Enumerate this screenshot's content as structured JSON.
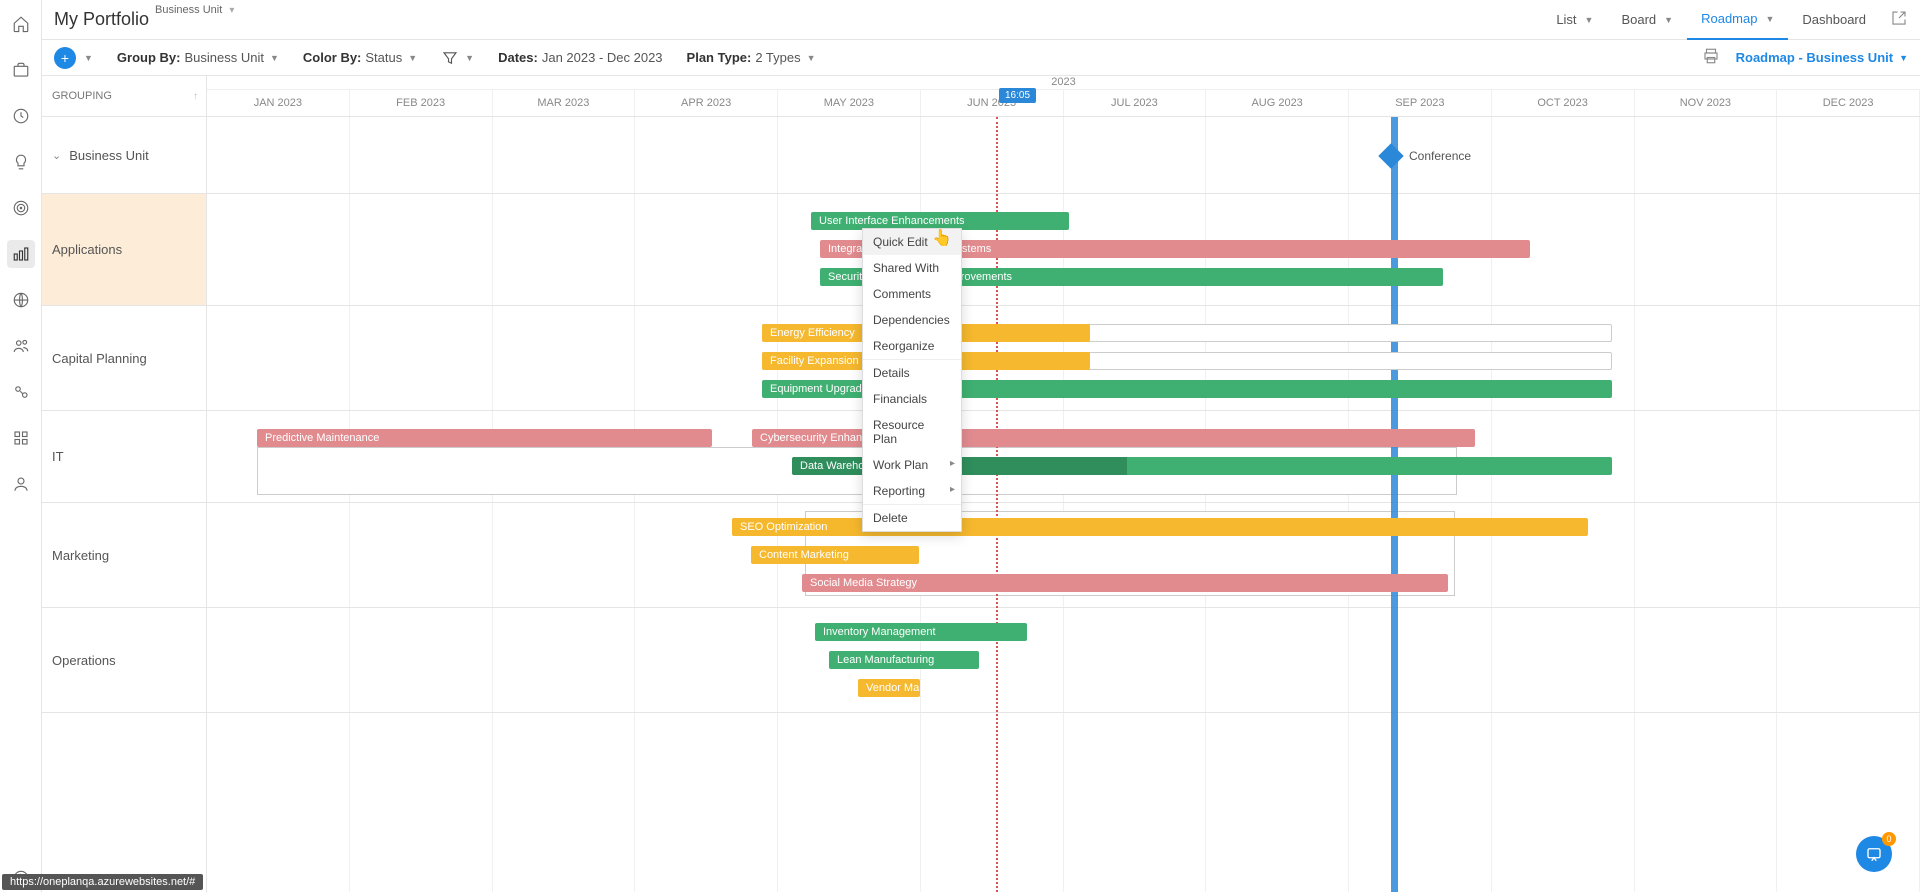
{
  "header": {
    "title": "My Portfolio",
    "subtitle": "Business Unit",
    "views": {
      "list": "List",
      "board": "Board",
      "roadmap": "Roadmap",
      "dashboard": "Dashboard"
    }
  },
  "toolbar": {
    "group_by_label": "Group By:",
    "group_by_value": "Business Unit",
    "color_by_label": "Color By:",
    "color_by_value": "Status",
    "dates_label": "Dates:",
    "dates_value": "Jan 2023 - Dec 2023",
    "plan_type_label": "Plan Type:",
    "plan_type_value": "2 Types",
    "view_name": "Roadmap - Business Unit"
  },
  "grouping_header": "GROUPING",
  "year": "2023",
  "months": [
    "JAN 2023",
    "FEB 2023",
    "MAR 2023",
    "APR 2023",
    "MAY 2023",
    "JUN 2023",
    "JUL 2023",
    "AUG 2023",
    "SEP 2023",
    "OCT 2023",
    "NOV 2023",
    "DEC 2023"
  ],
  "today_marker": "16:05",
  "groups": {
    "parent": "Business Unit",
    "applications": "Applications",
    "capital": "Capital Planning",
    "it": "IT",
    "marketing": "Marketing",
    "operations": "Operations"
  },
  "milestone": {
    "label": "Conference"
  },
  "bars": {
    "ui_enh": "User Interface Enhancements",
    "integration": "Integration with External Systems",
    "security": "Security & Compliance Improvements",
    "energy": "Energy Efficiency",
    "facility": "Facility Expansion",
    "equipment": "Equipment Upgrade",
    "predictive": "Predictive Maintenance",
    "cyber": "Cybersecurity Enhancement",
    "datawh": "Data Warehouse",
    "seo": "SEO Optimization",
    "content": "Content Marketing",
    "social": "Social Media Strategy",
    "inventory": "Inventory Management",
    "lean": "Lean Manufacturing",
    "vendor": "Vendor Mai"
  },
  "context_menu": {
    "quick_edit": "Quick Edit",
    "shared_with": "Shared With",
    "comments": "Comments",
    "dependencies": "Dependencies",
    "reorganize": "Reorganize",
    "details": "Details",
    "financials": "Financials",
    "resource_plan": "Resource Plan",
    "work_plan": "Work Plan",
    "reporting": "Reporting",
    "delete": "Delete"
  },
  "status_url": "https://oneplanqa.azurewebsites.net/#",
  "fab_badge": "0"
}
